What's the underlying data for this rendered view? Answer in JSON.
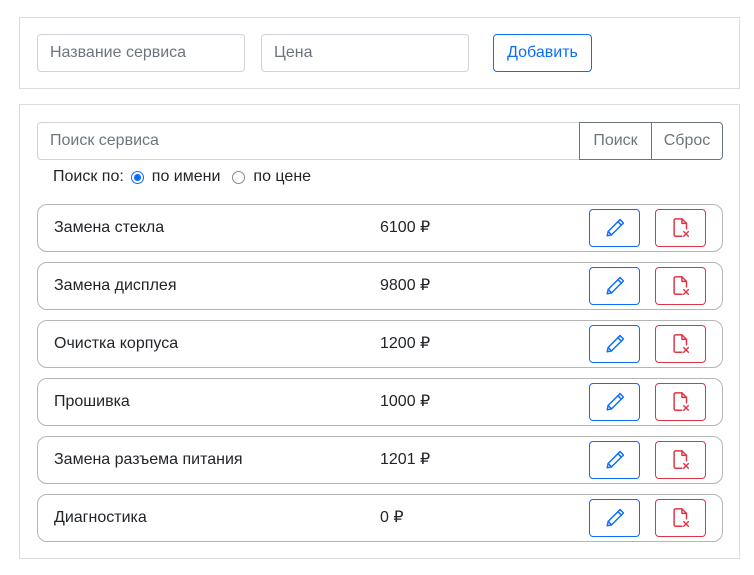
{
  "add_form": {
    "name_placeholder": "Название сервиса",
    "price_placeholder": "Цена",
    "add_label": "Добавить"
  },
  "search": {
    "placeholder": "Поиск сервиса",
    "search_label": "Поиск",
    "reset_label": "Сброс",
    "by_label": "Поиск по:",
    "options": [
      {
        "label": "по имени",
        "checked": true
      },
      {
        "label": "по цене",
        "checked": false
      }
    ]
  },
  "services": [
    {
      "name": "Замена стекла",
      "price": "6100 ₽"
    },
    {
      "name": "Замена дисплея",
      "price": "9800 ₽"
    },
    {
      "name": "Очистка корпуса",
      "price": "1200 ₽"
    },
    {
      "name": "Прошивка",
      "price": "1000 ₽"
    },
    {
      "name": "Замена разъема питания",
      "price": "1201 ₽"
    },
    {
      "name": "Диагностика",
      "price": "0 ₽"
    }
  ],
  "icons": {
    "edit": "pencil-icon",
    "delete": "file-x-icon"
  },
  "colors": {
    "primary": "#0d6efd",
    "danger": "#dc3545",
    "secondary": "#6c757d"
  }
}
